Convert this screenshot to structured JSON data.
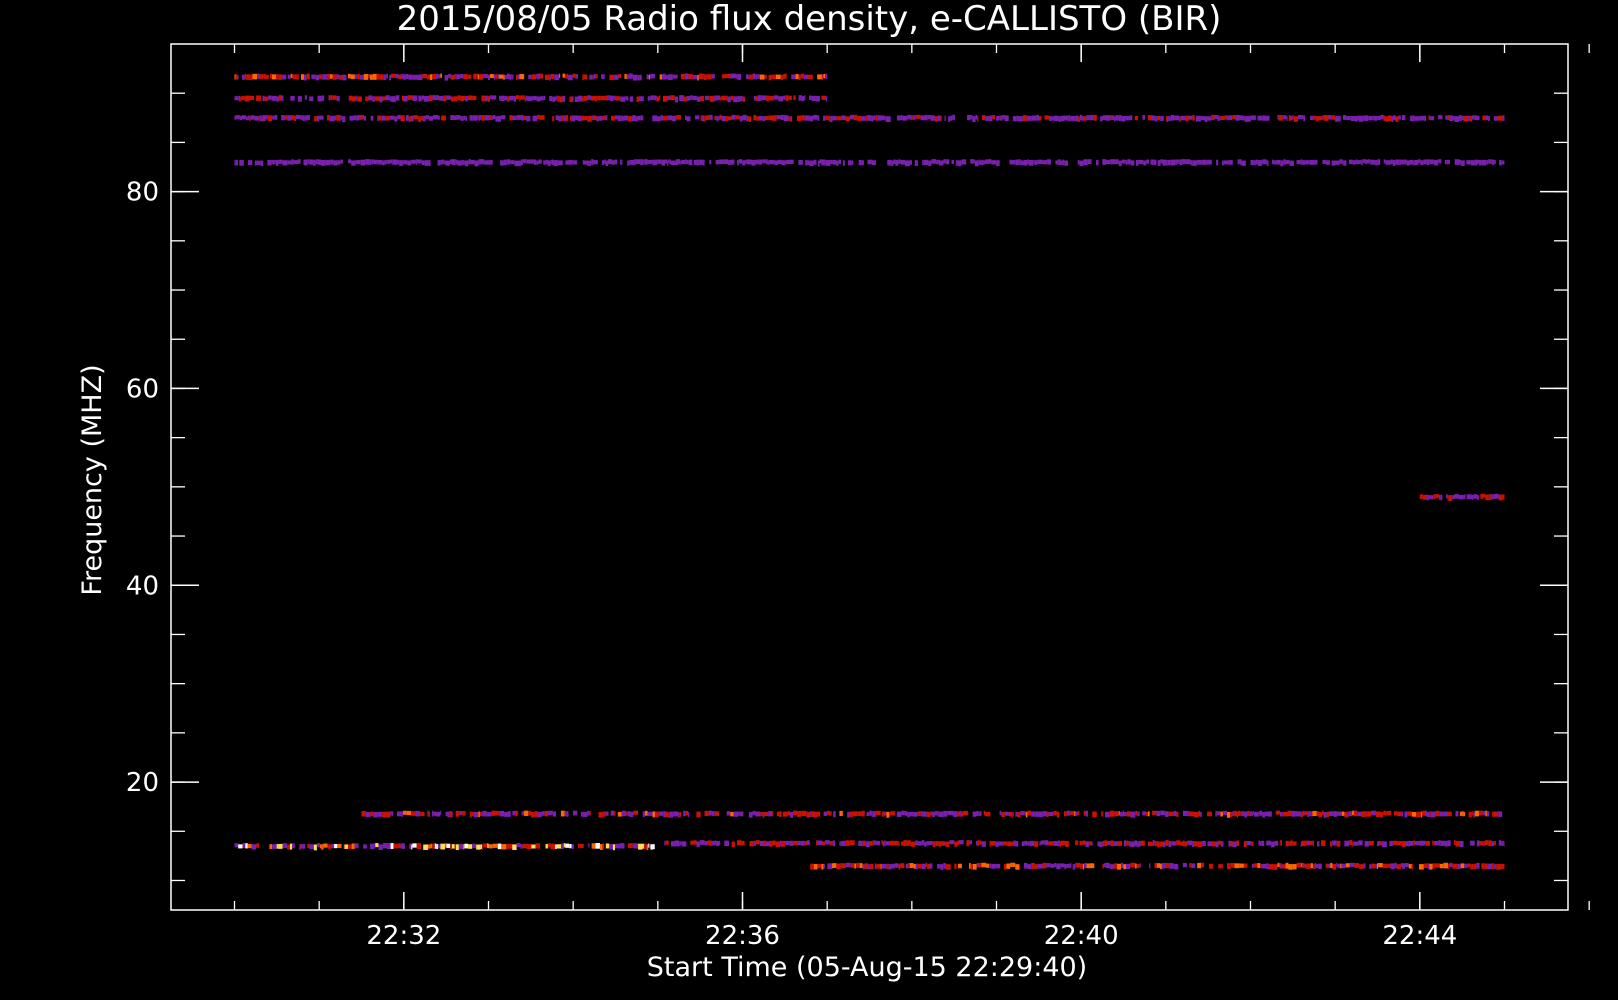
{
  "chart_data": {
    "type": "heatmap",
    "title": "2015/08/05  Radio flux density, e-CALLISTO (BIR)",
    "xlabel": "Start Time (05-Aug-15 22:29:40)",
    "ylabel": "Frequency (MHZ)",
    "x_tick_labels": [
      "22:32",
      "22:36",
      "22:40",
      "22:44"
    ],
    "x_tick_values_min": [
      0,
      1,
      2,
      3,
      4,
      5,
      6,
      7,
      8,
      9,
      10,
      11,
      12,
      13,
      14,
      15,
      16
    ],
    "y_tick_labels": [
      "20",
      "40",
      "60",
      "80"
    ],
    "y_tick_values": [
      20,
      40,
      60,
      80
    ],
    "y_minor_values": [
      10,
      15,
      20,
      25,
      30,
      35,
      40,
      45,
      50,
      55,
      60,
      65,
      70,
      75,
      80,
      85,
      90
    ],
    "xlim_minutes_after_2230": [
      -0.75,
      15.75
    ],
    "data_time_range_minutes_after_2230": [
      0.0,
      15.0
    ],
    "ylim_mhz": [
      95,
      7
    ],
    "data_freq_range_mhz": [
      9.5,
      93.5
    ],
    "y_reversed": true,
    "background_color": "#1a1aff",
    "colormap": [
      "#000000",
      "#1a1aff",
      "#7a1fb0",
      "#cc1100",
      "#ff6600",
      "#ffdd55",
      "#ffffff"
    ],
    "bright_bands": [
      {
        "freq_mhz": 11.5,
        "t_start_min": 6.8,
        "t_end_min": 15.0,
        "intensity": 0.7
      },
      {
        "freq_mhz": 13.5,
        "t_start_min": 0.0,
        "t_end_min": 5.0,
        "intensity": 1.0
      },
      {
        "freq_mhz": 13.8,
        "t_start_min": 5.0,
        "t_end_min": 15.0,
        "intensity": 0.45
      },
      {
        "freq_mhz": 16.8,
        "t_start_min": 1.5,
        "t_end_min": 15.0,
        "intensity": 0.55
      },
      {
        "freq_mhz": 49.0,
        "t_start_min": 14.0,
        "t_end_min": 15.0,
        "intensity": 0.4
      },
      {
        "freq_mhz": 83.0,
        "t_start_min": 0.0,
        "t_end_min": 15.0,
        "intensity": 0.25
      },
      {
        "freq_mhz": 87.5,
        "t_start_min": 0.0,
        "t_end_min": 15.0,
        "intensity": 0.35
      },
      {
        "freq_mhz": 89.5,
        "t_start_min": 0.0,
        "t_end_min": 7.0,
        "intensity": 0.4
      },
      {
        "freq_mhz": 91.7,
        "t_start_min": 0.0,
        "t_end_min": 7.0,
        "intensity": 0.6
      }
    ],
    "dark_bands": [
      {
        "freq_mhz": 12.8,
        "t_start_min": 0.0,
        "t_end_min": 15.0
      },
      {
        "freq_mhz": 16.3,
        "t_start_min": 0.0,
        "t_end_min": 15.0
      },
      {
        "freq_mhz": 43.3,
        "t_start_min": 0.0,
        "t_end_min": 15.0
      },
      {
        "freq_mhz": 89.8,
        "t_start_min": 8.5,
        "t_end_min": 15.0
      },
      {
        "freq_mhz": 91.7,
        "t_start_min": 9.0,
        "t_end_min": 15.0
      }
    ]
  }
}
